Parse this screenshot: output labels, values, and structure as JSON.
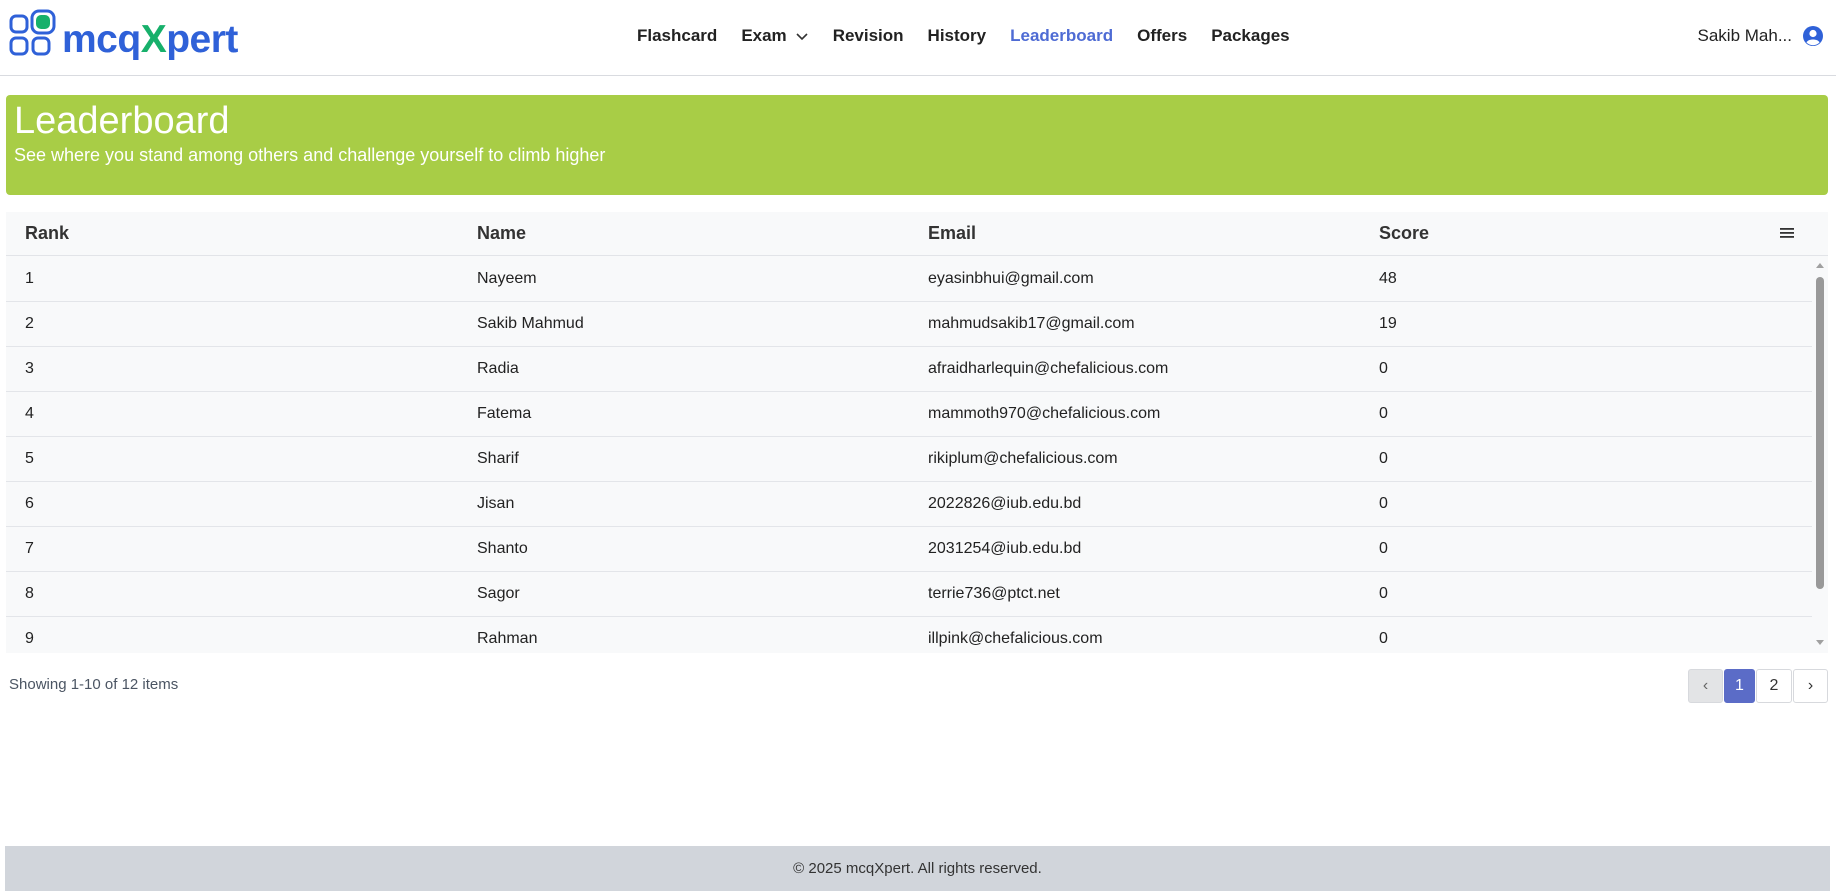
{
  "header": {
    "logo_prefix": "mcq",
    "logo_x": "X",
    "logo_suffix": "pert",
    "nav": [
      {
        "label": "Flashcard"
      },
      {
        "label": "Exam"
      },
      {
        "label": "Revision"
      },
      {
        "label": "History"
      },
      {
        "label": "Leaderboard",
        "active": true
      },
      {
        "label": "Offers"
      },
      {
        "label": "Packages"
      }
    ],
    "user_name": "Sakib Mah...",
    "icons": {
      "exam_dropdown": "chevron-down-icon",
      "user": "user-circle-icon"
    }
  },
  "banner": {
    "title": "Leaderboard",
    "subtitle": "See where you stand among others and challenge yourself to climb higher",
    "color": "#a8cd46"
  },
  "table": {
    "columns": [
      "Rank",
      "Name",
      "Email",
      "Score"
    ],
    "menu_icon": "hamburger-menu-icon",
    "rows": [
      {
        "rank": "1",
        "name": "Nayeem",
        "email": "eyasinbhui@gmail.com",
        "score": "48"
      },
      {
        "rank": "2",
        "name": "Sakib Mahmud",
        "email": "mahmudsakib17@gmail.com",
        "score": "19"
      },
      {
        "rank": "3",
        "name": "Radia",
        "email": "afraidharlequin@chefalicious.com",
        "score": "0"
      },
      {
        "rank": "4",
        "name": "Fatema",
        "email": "mammoth970@chefalicious.com",
        "score": "0"
      },
      {
        "rank": "5",
        "name": "Sharif",
        "email": "rikiplum@chefalicious.com",
        "score": "0"
      },
      {
        "rank": "6",
        "name": "Jisan",
        "email": "2022826@iub.edu.bd",
        "score": "0"
      },
      {
        "rank": "7",
        "name": "Shanto",
        "email": "2031254@iub.edu.bd",
        "score": "0"
      },
      {
        "rank": "8",
        "name": "Sagor",
        "email": "terrie736@ptct.net",
        "score": "0"
      },
      {
        "rank": "9",
        "name": "Rahman",
        "email": "illpink@chefalicious.com",
        "score": "0"
      }
    ]
  },
  "pagination": {
    "showing": "Showing 1-10 of 12 items",
    "prev": "‹",
    "pages": [
      "1",
      "2"
    ],
    "current": "1",
    "next": "›"
  },
  "footer": {
    "text": "© 2025 mcqXpert. All rights reserved."
  },
  "colors": {
    "brand_blue": "#2f61d8",
    "brand_green": "#17b06b",
    "active_nav": "#4e6bd4",
    "page_current": "#5b6cc7"
  }
}
